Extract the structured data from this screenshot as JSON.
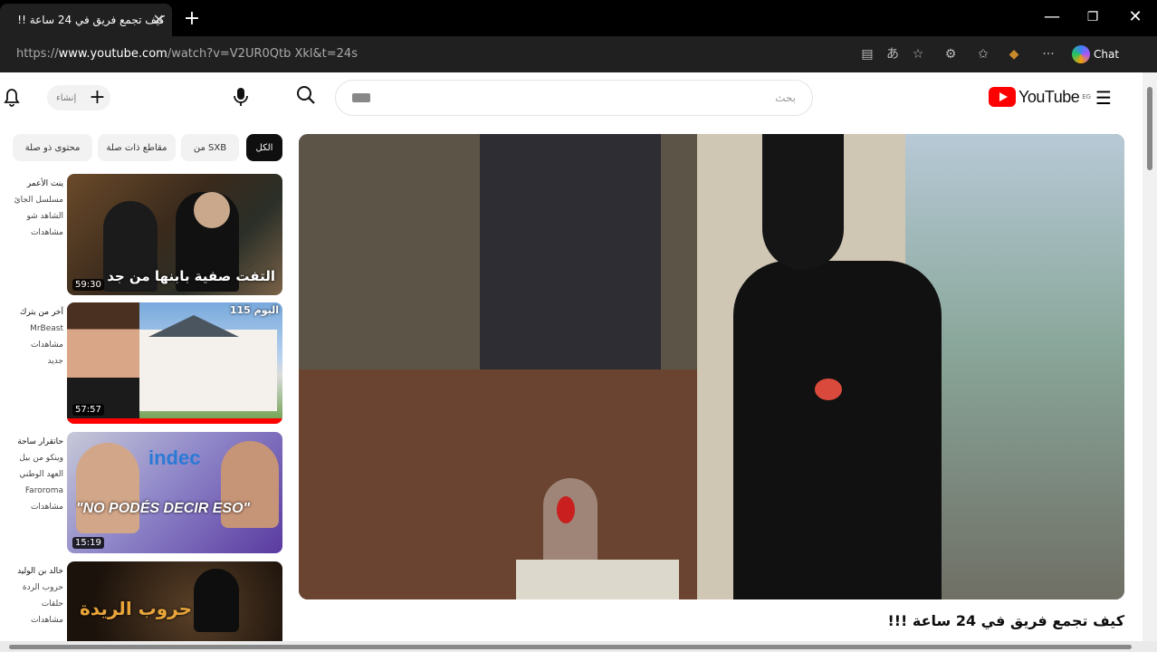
{
  "browser": {
    "tab_title": "كيف تجمع فريق في 24 ساعة !!",
    "tab_close": "✕",
    "new_tab": "+",
    "url_prefix": "https://",
    "url_domain": "www.youtube.com",
    "url_path": "/watch?v=V2UR0Qtb Xkl&t=24s",
    "chat_label": "Chat",
    "window": {
      "minimize": "—",
      "restore": "❐",
      "close": "✕"
    }
  },
  "youtube": {
    "logo_text": "YouTube",
    "logo_region": "EG",
    "create_label": "إنشاء",
    "search_placeholder": "بحث",
    "chips": [
      "الكل",
      "من SXB",
      "مقاطع ذات صلة",
      "محتوى ذو صلة"
    ],
    "video_title": "كيف تجمع فريق في 24 ساعة !!!"
  },
  "recommendations": [
    {
      "duration": "59:30",
      "thumb_text": "التفت صفية بابنها من جد",
      "meta": [
        "ينت الأعمر",
        "مسلسل الجائ",
        "الشاهد شو",
        "مشاهدات"
      ]
    },
    {
      "duration": "57:57",
      "thumb_text": "اليوم 115",
      "meta": [
        "آخر من يترك",
        "MrBeast",
        "مشاهدات",
        "جديد"
      ]
    },
    {
      "duration": "15:19",
      "thumb_text": "\"NO PODÉS DECIR ESO\"",
      "thumb_brand": "indec",
      "meta": [
        "حاتقرار ساحة",
        "وينكو من بيل",
        "العهد الوطني",
        "Faroroma",
        "مشاهدات"
      ]
    },
    {
      "duration": "",
      "thumb_text": "حروب الريدة",
      "meta": [
        "خالد بن الوليد",
        "حروب الردة",
        "حلقات",
        "مشاهدات"
      ]
    }
  ],
  "colors": {
    "brand_red": "#ff0000",
    "chip_active": "#0f0f0f",
    "chip": "#f2f2f2",
    "titlebar": "#000000",
    "addressbar": "#202020"
  }
}
